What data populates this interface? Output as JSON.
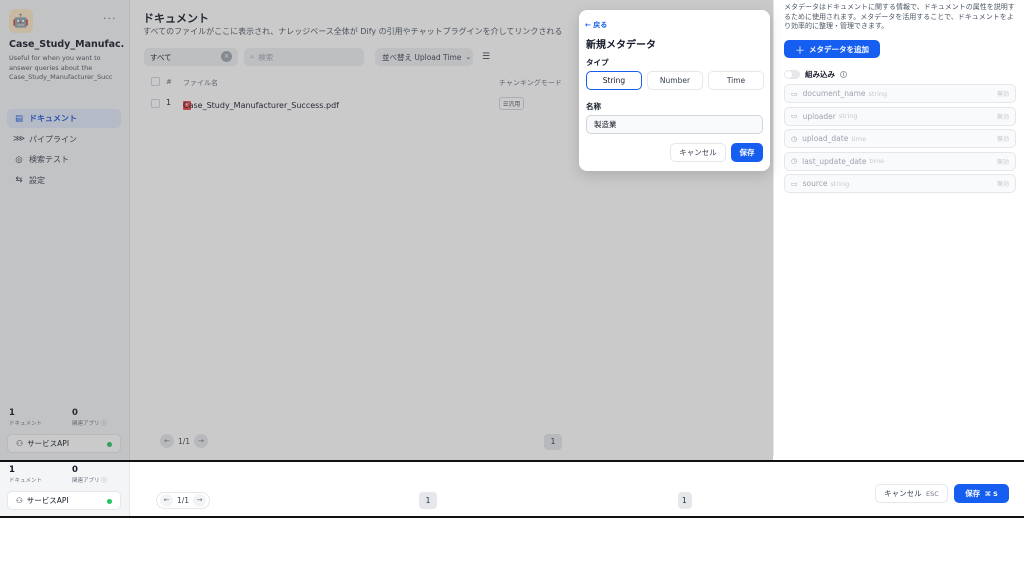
{
  "sidebar": {
    "app_icon": "robot-icon",
    "app_name": "Case_Study_Manufac...",
    "app_description": "Useful for when you want to answer queries about the Case_Study_Manufacturer_Succ",
    "nav": [
      {
        "label": "ドキュメント",
        "icon": "document-icon",
        "active": true
      },
      {
        "label": "パイプライン",
        "icon": "pipeline-icon",
        "active": false
      },
      {
        "label": "検索テスト",
        "icon": "target-icon",
        "active": false
      },
      {
        "label": "設定",
        "icon": "settings-icon",
        "active": false
      }
    ],
    "stats": {
      "documents_count": "1",
      "documents_label": "ドキュメント",
      "apps_count": "0",
      "apps_label": "関連アプリ ⓘ"
    },
    "service_api_label": "サービスAPI",
    "service_api_status_color": "#22c55e"
  },
  "main": {
    "title": "ドキュメント",
    "description": "すべてのファイルがここに表示され、ナレッジベース全体が Dify の引用やチャットプラグインを介してリンクされる",
    "filter_value": "すべて",
    "search_placeholder": "検索",
    "sort_label": "並べ替え Upload Time",
    "table": {
      "headers": [
        "#",
        "ファイル名",
        "チャンキングモード"
      ],
      "rows": [
        {
          "index": "1",
          "file_name": "Case_Study_Manufacturer_Success.pdf",
          "mode": "☰汎用"
        }
      ]
    },
    "pagination": {
      "text": "1/1",
      "current_page": "1"
    }
  },
  "popup": {
    "back_label": "← 戻る",
    "title": "新規メタデータ",
    "type_label": "タイプ",
    "types": [
      "String",
      "Number",
      "Time"
    ],
    "selected_type": "String",
    "name_label": "名称",
    "name_value": "製造業",
    "cancel_label": "キャンセル",
    "save_label": "保存"
  },
  "meta_panel": {
    "description": "メタデータはドキュメントに関する情報で、ドキュメントの属性を説明するために使用されます。メタデータを活用することで、ドキュメントをより効率的に整理・管理できます。",
    "add_button_label": "メタデータを追加",
    "builtin_label": "組み込み",
    "builtin_items": [
      {
        "name": "document_name",
        "type": "string",
        "state": "無効",
        "icon": "text-icon"
      },
      {
        "name": "uploader",
        "type": "string",
        "state": "無効",
        "icon": "text-icon"
      },
      {
        "name": "upload_date",
        "type": "time",
        "state": "無効",
        "icon": "clock-icon"
      },
      {
        "name": "last_update_date",
        "type": "time",
        "state": "無効",
        "icon": "clock-icon"
      },
      {
        "name": "source",
        "type": "string",
        "state": "無効",
        "icon": "text-icon"
      }
    ]
  },
  "bottom": {
    "documents_count": "1",
    "documents_label": "ドキュメント",
    "apps_count": "0",
    "apps_label": "関連アプリ ⓘ",
    "service_api_label": "サービスAPI",
    "pagination_text": "1/1",
    "current_page": "1",
    "page_partial": "1",
    "cancel_label": "キャンセル",
    "cancel_key": "ESC",
    "save_label": "保存",
    "save_key": "⌘ S"
  },
  "colors": {
    "accent": "#155eef",
    "active_nav_bg": "#e1e8fb",
    "status_green": "#22c55e"
  }
}
